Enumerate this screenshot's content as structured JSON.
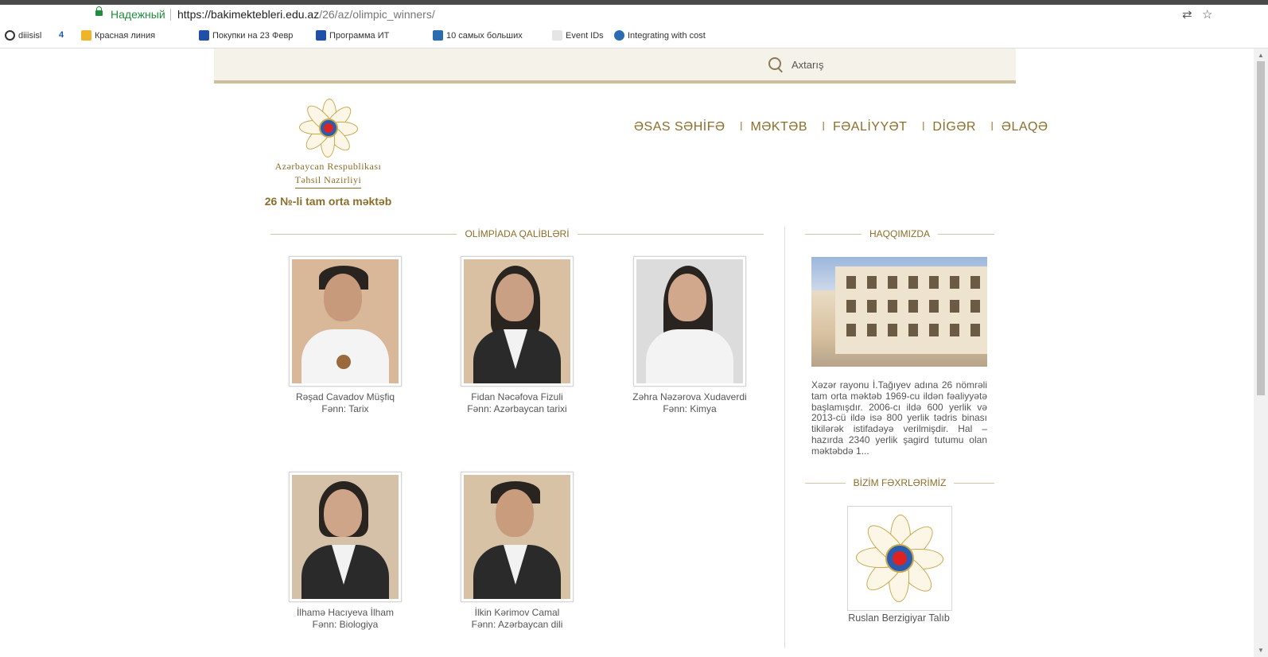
{
  "browser": {
    "secure_label": "Надежный",
    "url_host": "https://bakimektebleri.edu.az",
    "url_path": "/26/az/olimpic_winners/",
    "bookmarks": [
      {
        "label": "diiisisl"
      },
      {
        "label": "4"
      },
      {
        "label": "Красная линия"
      },
      {
        "label": "Покупки на 23 Февр"
      },
      {
        "label": "Программа ИТ"
      },
      {
        "label": "10 самых больших"
      },
      {
        "label": "Event IDs"
      },
      {
        "label": "Integrating with cost"
      }
    ]
  },
  "header": {
    "search_label": "Axtarış"
  },
  "logo": {
    "line1": "Azərbaycan Respublikası",
    "line2": "Təhsil Nazirliyi",
    "school": "26 №-li tam orta məktəb"
  },
  "nav": {
    "items": [
      "ƏSAS SƏHİFƏ",
      "MƏKTƏB",
      "FƏALİYYƏT",
      "DİGƏR",
      "ƏLAQƏ"
    ]
  },
  "main": {
    "section_title": "OLİMPİADA QALİBLƏRİ",
    "winners": [
      {
        "name": "Rəşad Cavadov Müşfiq",
        "subject": "Fənn: Tarix"
      },
      {
        "name": "Fidan Nəcəfova Fizuli",
        "subject": "Fənn: Azərbaycan tarixi"
      },
      {
        "name": "Zəhra Nəzərova Xudaverdi",
        "subject": "Fənn: Kimya"
      },
      {
        "name": "İlhamə Hacıyeva İlham",
        "subject": "Fənn: Biologiya"
      },
      {
        "name": "İlkin Kərimov Camal",
        "subject": "Fənn: Azərbaycan dili"
      }
    ]
  },
  "sidebar": {
    "about_title": "HAQQIMIZDA",
    "about_text": "Xəzər rayonu İ.Tağıyev adına 26 nömrəli tam orta məktəb 1969-cu ildən fəaliyyətə başlamışdır. 2006-cı ildə 600 yerlik və 2013-cü ildə isə 800 yerlik tədris binası tikilərək istifadəyə verilmişdir. Hal – hazırda 2340 yerlik şagird tutumu olan məktəbdə 1...",
    "pride_title": "BİZİM FƏXRLƏRİMİZ",
    "pride_name": "Ruslan Berzigiyar Talıb"
  },
  "colors": {
    "gold": "#8b6d2a",
    "header_bg": "#f5f2ea",
    "secure_green": "#1e8e3e"
  }
}
